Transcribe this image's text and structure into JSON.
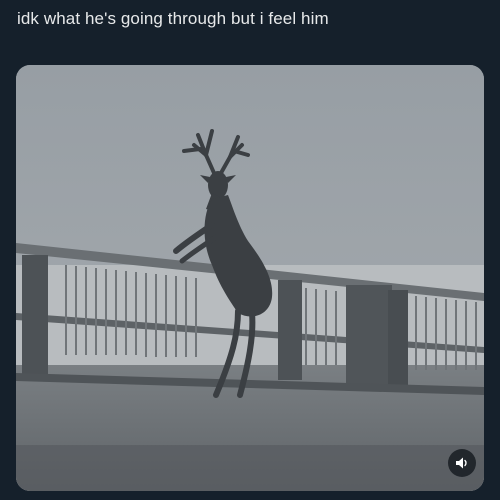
{
  "post": {
    "text": "idk what he's going through but i feel him"
  },
  "media": {
    "type": "video",
    "subject": "deer-standing-on-hind-legs-at-railing",
    "controls": {
      "audio_icon": "speaker-icon"
    }
  },
  "colors": {
    "background": "#15202b",
    "text": "#e7e9ea",
    "sky": "#9aa1a6",
    "ground": "#6f7478"
  }
}
